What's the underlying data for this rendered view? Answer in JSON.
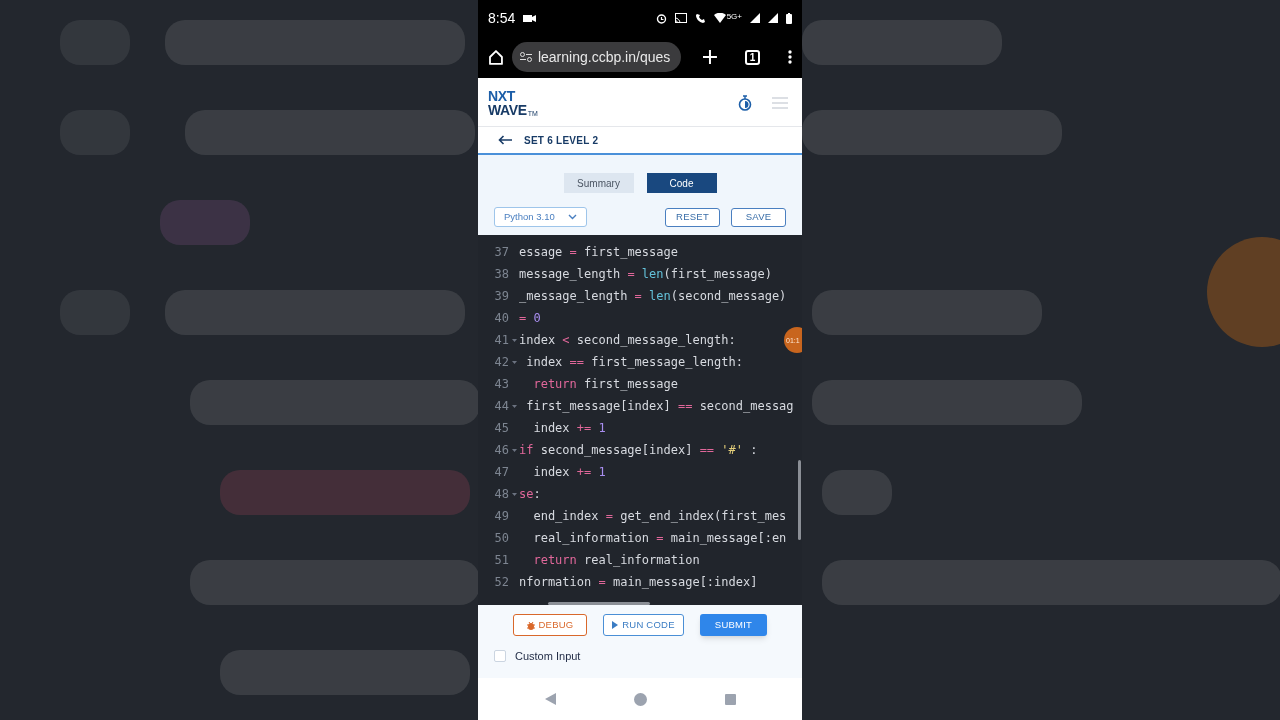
{
  "status_bar": {
    "time": "8:54",
    "network": "5G+"
  },
  "browser": {
    "url": "learning.ccbp.in/ques",
    "tab_count": "1"
  },
  "logo": {
    "line_1": "NXT",
    "line_2": "WAVE",
    "mark": "TM"
  },
  "breadcrumb": {
    "title": "SET 6 LEVEL 2"
  },
  "tabs": [
    {
      "label": "Summary",
      "selected": false
    },
    {
      "label": "Code",
      "selected": true
    }
  ],
  "language_select": {
    "value": "Python 3.10"
  },
  "toolbar_buttons": [
    "RESET",
    "SAVE"
  ],
  "editor": {
    "lines": [
      {
        "number": "37",
        "foldable": false,
        "tokens": [
          {
            "text": "essage ",
            "kind": "plain"
          },
          {
            "text": "=",
            "kind": "operator"
          },
          {
            "text": " first_message",
            "kind": "plain"
          }
        ]
      },
      {
        "number": "38",
        "foldable": false,
        "tokens": [
          {
            "text": "message_length ",
            "kind": "plain"
          },
          {
            "text": "= ",
            "kind": "operator"
          },
          {
            "text": "len",
            "kind": "builtin"
          },
          {
            "text": "(first_message)",
            "kind": "plain"
          }
        ]
      },
      {
        "number": "39",
        "foldable": false,
        "tokens": [
          {
            "text": "_message_length ",
            "kind": "plain"
          },
          {
            "text": "= ",
            "kind": "operator"
          },
          {
            "text": "len",
            "kind": "builtin"
          },
          {
            "text": "(second_message)",
            "kind": "plain"
          }
        ]
      },
      {
        "number": "40",
        "foldable": false,
        "tokens": [
          {
            "text": "= ",
            "kind": "operator"
          },
          {
            "text": "0",
            "kind": "number"
          }
        ]
      },
      {
        "number": "41",
        "foldable": true,
        "tokens": [
          {
            "text": "index ",
            "kind": "plain"
          },
          {
            "text": "<",
            "kind": "operator"
          },
          {
            "text": " second_message_length:",
            "kind": "plain"
          }
        ]
      },
      {
        "number": "42",
        "foldable": true,
        "tokens": [
          {
            "text": " index ",
            "kind": "plain"
          },
          {
            "text": "==",
            "kind": "operator"
          },
          {
            "text": " first_message_length:",
            "kind": "plain"
          }
        ]
      },
      {
        "number": "43",
        "foldable": false,
        "tokens": [
          {
            "text": "  return",
            "kind": "keyword"
          },
          {
            "text": " first_message",
            "kind": "plain"
          }
        ]
      },
      {
        "number": "44",
        "foldable": true,
        "tokens": [
          {
            "text": " first_message[index] ",
            "kind": "plain"
          },
          {
            "text": "==",
            "kind": "operator"
          },
          {
            "text": " second_messag",
            "kind": "plain"
          }
        ]
      },
      {
        "number": "45",
        "foldable": false,
        "tokens": [
          {
            "text": "  index ",
            "kind": "plain"
          },
          {
            "text": "+= ",
            "kind": "operator"
          },
          {
            "text": "1",
            "kind": "number"
          }
        ]
      },
      {
        "number": "46",
        "foldable": true,
        "tokens": [
          {
            "text": "if",
            "kind": "keyword"
          },
          {
            "text": " second_message[index] ",
            "kind": "plain"
          },
          {
            "text": "== ",
            "kind": "operator"
          },
          {
            "text": "'#'",
            "kind": "string"
          },
          {
            "text": " :",
            "kind": "plain"
          }
        ]
      },
      {
        "number": "47",
        "foldable": false,
        "tokens": [
          {
            "text": "  index ",
            "kind": "plain"
          },
          {
            "text": "+= ",
            "kind": "operator"
          },
          {
            "text": "1",
            "kind": "number"
          }
        ]
      },
      {
        "number": "48",
        "foldable": true,
        "tokens": [
          {
            "text": "se",
            "kind": "keyword"
          },
          {
            "text": ":",
            "kind": "plain"
          }
        ]
      },
      {
        "number": "49",
        "foldable": false,
        "tokens": [
          {
            "text": "  end_index ",
            "kind": "plain"
          },
          {
            "text": "=",
            "kind": "operator"
          },
          {
            "text": " get_end_index(first_mes",
            "kind": "plain"
          }
        ]
      },
      {
        "number": "50",
        "foldable": false,
        "tokens": [
          {
            "text": "  real_information ",
            "kind": "plain"
          },
          {
            "text": "=",
            "kind": "operator"
          },
          {
            "text": " main_message[:en",
            "kind": "plain"
          }
        ]
      },
      {
        "number": "51",
        "foldable": false,
        "tokens": [
          {
            "text": "  return",
            "kind": "keyword"
          },
          {
            "text": " real_information",
            "kind": "plain"
          }
        ]
      },
      {
        "number": "52",
        "foldable": false,
        "tokens": [
          {
            "text": "nformation ",
            "kind": "plain"
          },
          {
            "text": "=",
            "kind": "operator"
          },
          {
            "text": " main_message[:index]",
            "kind": "plain"
          }
        ]
      }
    ]
  },
  "timer_bubble": "01:1",
  "actions": [
    {
      "label": "DEBUG",
      "kind": "debug"
    },
    {
      "label": "RUN CODE",
      "kind": "run"
    },
    {
      "label": "SUBMIT",
      "kind": "submit"
    }
  ],
  "custom_input": {
    "label": "Custom Input",
    "checked": false
  }
}
